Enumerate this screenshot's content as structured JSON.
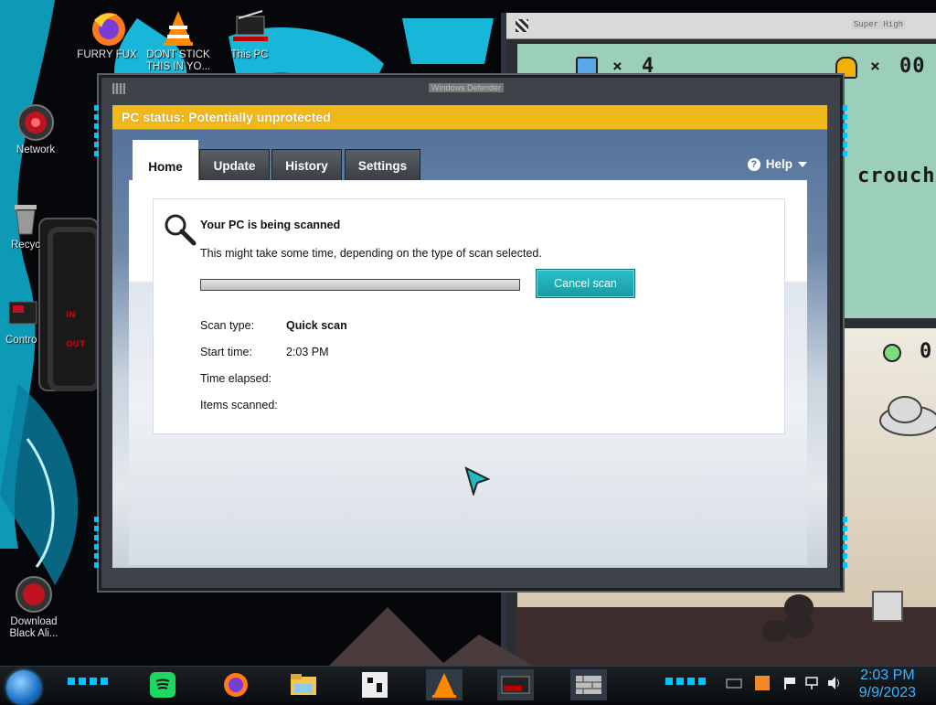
{
  "desktop": {
    "icons": [
      {
        "label": "FURRY FUX",
        "icon": "firefox-icon"
      },
      {
        "label": "DONT STICK\nTHIS IN YO...",
        "icon": "vlc-icon"
      },
      {
        "label": "This PC",
        "icon": "this-pc-icon"
      },
      {
        "label": "Network",
        "icon": "network-icon"
      },
      {
        "label": "Recyc",
        "icon": "recycle-bin-icon"
      },
      {
        "label": "Contro",
        "icon": "control-panel-icon"
      },
      {
        "label": "Download\nBlack Ali...",
        "icon": "download-icon"
      }
    ],
    "gadget": {
      "in_label": "IN",
      "out_label": "OUT"
    }
  },
  "game_window": {
    "title": "Super High",
    "hud_lives": "4",
    "hud_bells": "00",
    "hud_time": "0",
    "text_crouch": "crouch"
  },
  "defender": {
    "window_title": "Windows Defender",
    "status": "PC status: Potentially unprotected",
    "status_color": "#f0b819",
    "tabs": [
      "Home",
      "Update",
      "History",
      "Settings"
    ],
    "active_tab": "Home",
    "help_label": "Help",
    "scan": {
      "heading": "Your PC is being scanned",
      "description": "This might take some time, depending on the type of scan selected.",
      "cancel_label": "Cancel scan",
      "details": [
        {
          "label": "Scan type:",
          "value": "Quick scan"
        },
        {
          "label": "Start time:",
          "value": "2:03 PM"
        },
        {
          "label": "Time elapsed:",
          "value": ""
        },
        {
          "label": "Items scanned:",
          "value": ""
        }
      ]
    }
  },
  "taskbar": {
    "pinned": [
      "spotify-icon",
      "firefox-icon",
      "file-explorer-icon",
      "game-icon",
      "vlc-icon",
      "photo-app-icon",
      "wall-app-icon"
    ],
    "clock_time": "2:03 PM",
    "clock_date": "9/9/2023",
    "accent_color": "#35b8ff"
  }
}
